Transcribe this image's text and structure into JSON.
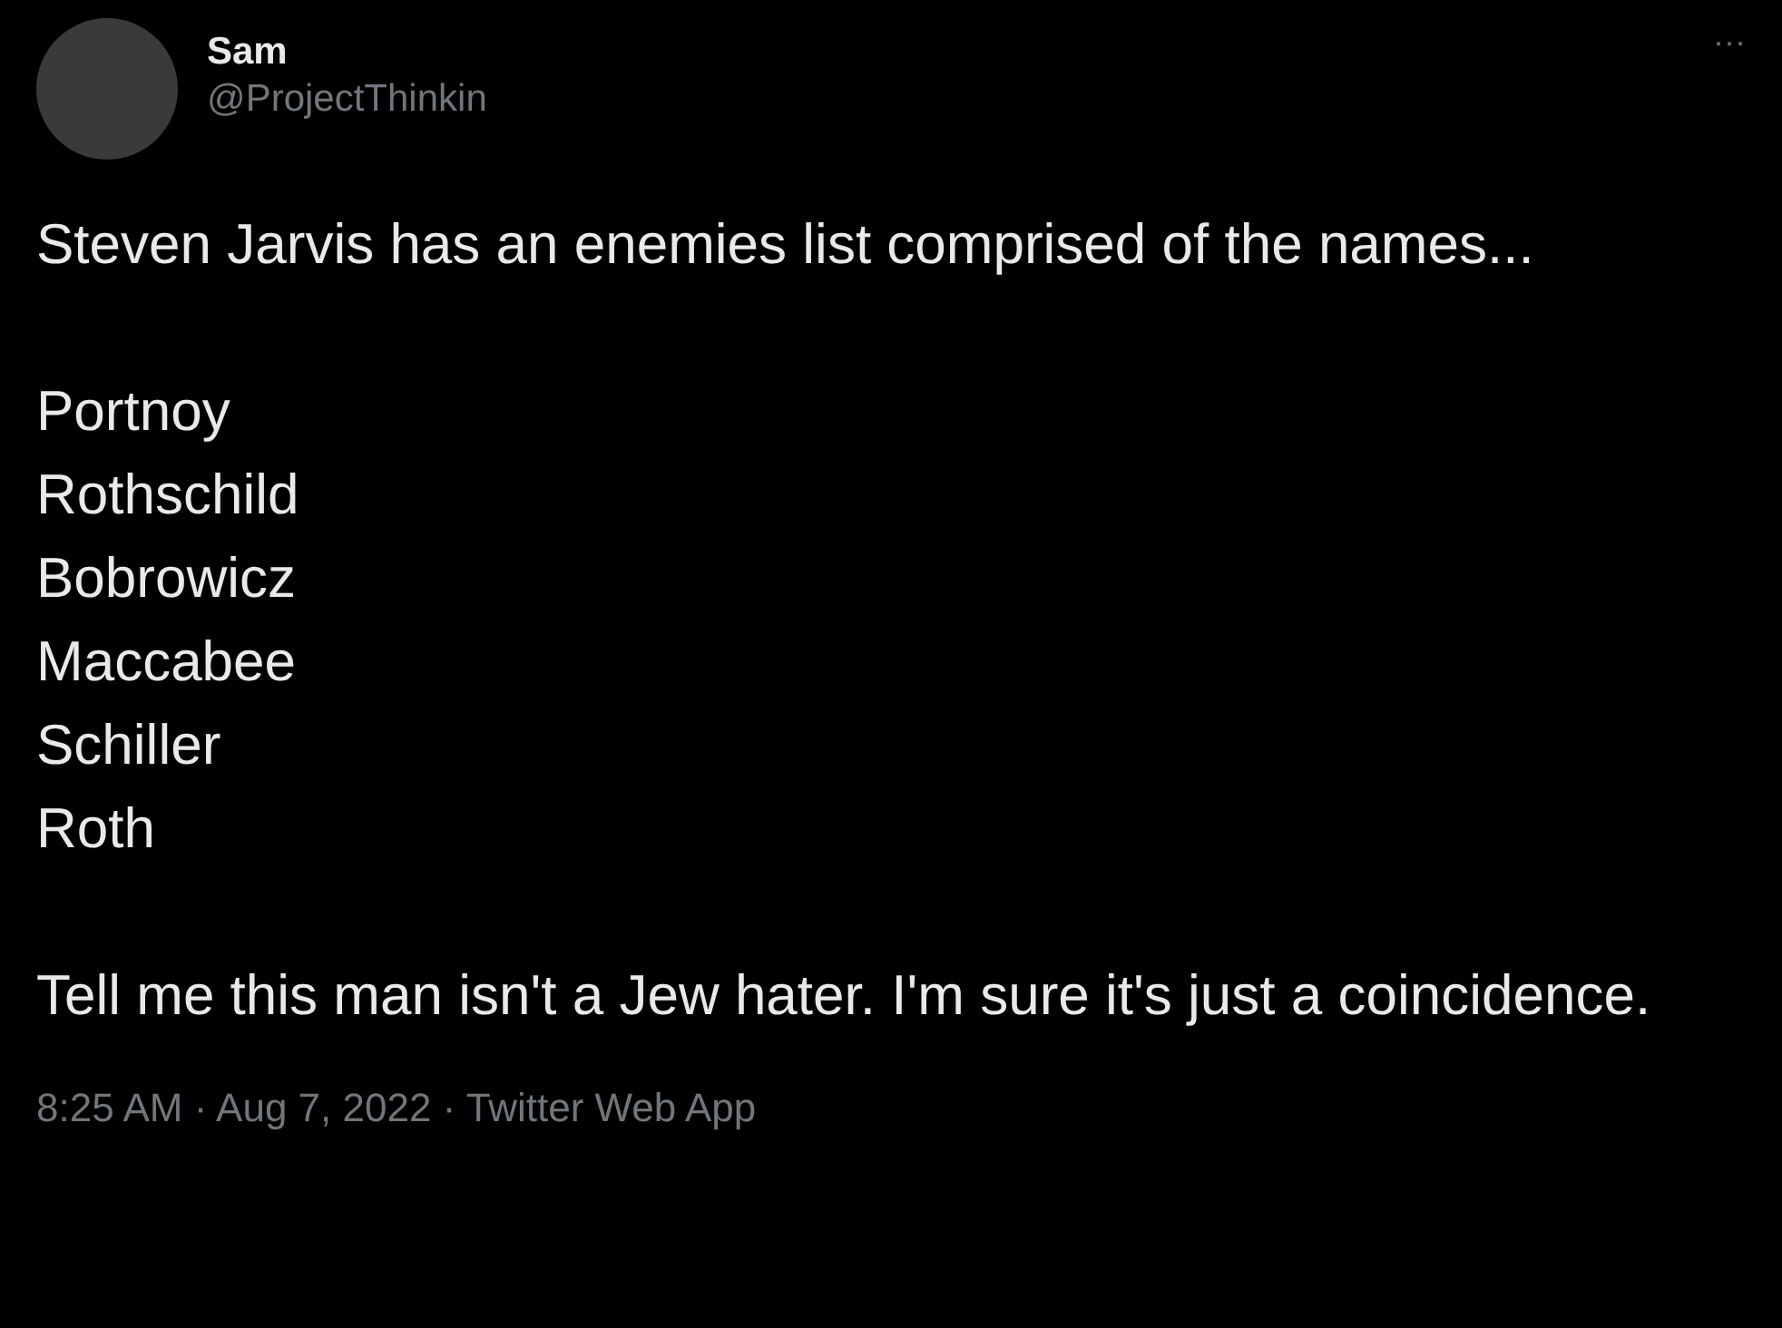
{
  "author": {
    "name": "Sam",
    "handle": "@ProjectThinkin"
  },
  "more_menu": "···",
  "tweet_text": "Steven Jarvis has an enemies list comprised of the names...\n\nPortnoy\nRothschild\nBobrowicz\nMaccabee\nSchiller\nRoth\n\nTell me this man isn't a Jew hater. I'm sure it's just a coincidence.",
  "footer": "8:25 AM · Aug 7, 2022 · Twitter Web App"
}
